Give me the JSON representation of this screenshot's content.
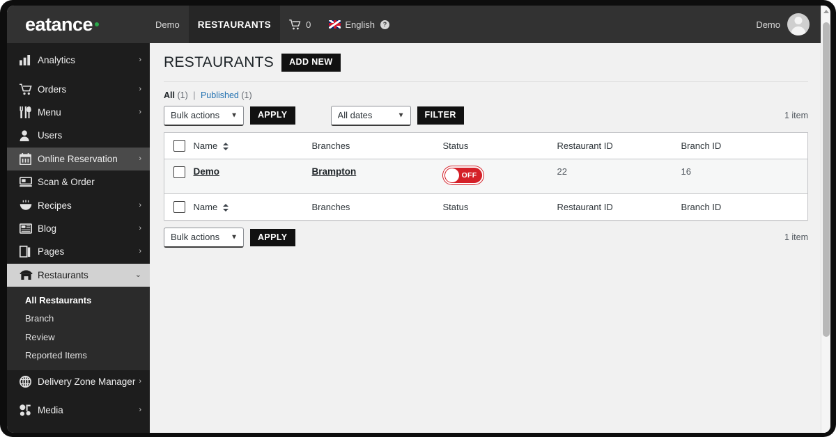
{
  "brand": {
    "name": "eatance",
    "dot_color": "#2ba84a"
  },
  "adminbar": {
    "site_name": "Demo",
    "active_tab": "RESTAURANTS",
    "cart_count": "0",
    "language": "English",
    "help_glyph": "?",
    "user_name": "Demo"
  },
  "sidebar": {
    "items": [
      {
        "label": "Analytics",
        "icon": "chart-bar-icon",
        "arrow": "›",
        "state": "normal"
      },
      {
        "label": "Orders",
        "icon": "shopping-cart-icon",
        "arrow": "›",
        "state": "normal"
      },
      {
        "label": "Menu",
        "icon": "fork-knife-icon",
        "arrow": "›",
        "state": "normal"
      },
      {
        "label": "Users",
        "icon": "user-icon",
        "arrow": "",
        "state": "normal"
      },
      {
        "label": "Online Reservation",
        "icon": "calendar-icon",
        "arrow": "›",
        "state": "hover"
      },
      {
        "label": "Scan & Order",
        "icon": "scan-device-icon",
        "arrow": "",
        "state": "normal"
      },
      {
        "label": "Recipes",
        "icon": "recipe-bowl-icon",
        "arrow": "›",
        "state": "normal"
      },
      {
        "label": "Blog",
        "icon": "blog-icon",
        "arrow": "›",
        "state": "normal"
      },
      {
        "label": "Pages",
        "icon": "pages-icon",
        "arrow": "›",
        "state": "normal"
      },
      {
        "label": "Restaurants",
        "icon": "storefront-icon",
        "arrow": "⌄",
        "state": "current"
      }
    ],
    "submenu": [
      {
        "label": "All Restaurants",
        "active": true
      },
      {
        "label": "Branch",
        "active": false
      },
      {
        "label": "Review",
        "active": false
      },
      {
        "label": "Reported Items",
        "active": false
      }
    ],
    "items_after": [
      {
        "label": "Delivery Zone Manager",
        "icon": "globe-icon",
        "arrow": "›",
        "state": "normal"
      },
      {
        "label": "Media",
        "icon": "media-icon",
        "arrow": "›",
        "state": "normal"
      }
    ]
  },
  "page": {
    "title": "RESTAURANTS",
    "add_new_label": "ADD NEW"
  },
  "views": {
    "all_label": "All",
    "all_count": "(1)",
    "separator": "|",
    "published_label": "Published",
    "published_count": "(1)"
  },
  "tablenav_top": {
    "bulk_actions_value": "Bulk actions",
    "apply_label": "APPLY",
    "dates_value": "All dates",
    "filter_label": "FILTER",
    "item_count": "1 item"
  },
  "tablenav_bottom": {
    "bulk_actions_value": "Bulk actions",
    "apply_label": "APPLY",
    "item_count": "1 item"
  },
  "table": {
    "columns": {
      "name": "Name",
      "branches": "Branches",
      "status": "Status",
      "restaurant_id": "Restaurant ID",
      "branch_id": "Branch ID"
    },
    "rows": [
      {
        "name": "Demo",
        "branch": "Brampton",
        "status_label": "OFF",
        "status_on": false,
        "restaurant_id": "22",
        "branch_id": "16"
      }
    ]
  },
  "colors": {
    "adminbar_bg": "#323232",
    "sidebar_bg": "#1d1d1d",
    "toggle_off": "#d42028",
    "link_blue": "#2271b1",
    "button_dark": "#111111"
  }
}
